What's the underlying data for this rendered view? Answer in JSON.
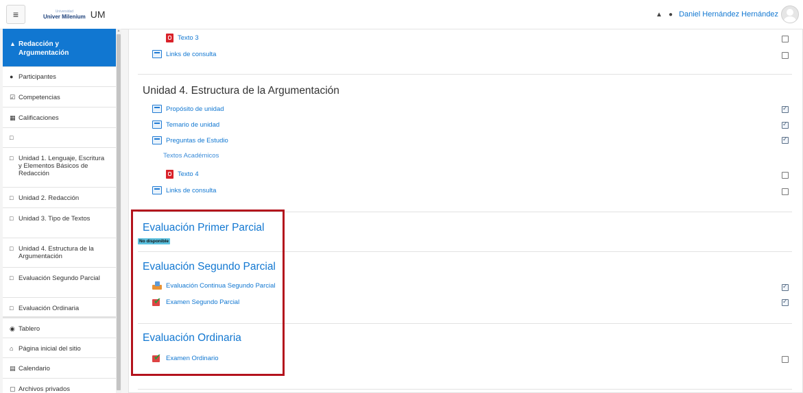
{
  "navbar": {
    "menu_icon": "≡",
    "logo_top": "Universidad",
    "logo_main": "Univer Milenium",
    "site_name": "UM",
    "bell_icon": "🔔",
    "chat_icon": "💬",
    "user_name": "Daniel Hernández Hernández"
  },
  "drawer": {
    "items": [
      {
        "icon": "🎓",
        "label": "Redacción y Argumentación",
        "active": true
      },
      {
        "icon": "👥",
        "label": "Participantes"
      },
      {
        "icon": "☑",
        "label": "Competencias"
      },
      {
        "icon": "▦",
        "label": "Calificaciones"
      },
      {
        "icon": "🗀",
        "label": ""
      },
      {
        "icon": "🗀",
        "label": "Unidad 1. Lenguaje, Escritura y Elementos Básicos de Redacción"
      },
      {
        "icon": "🗀",
        "label": "Unidad 2. Redacción"
      },
      {
        "icon": "🗀",
        "label": "Unidad 3. Tipo de Textos"
      },
      {
        "icon": "🗀",
        "label": "Unidad 4. Estructura de la Argumentación"
      },
      {
        "icon": "🗀",
        "label": "Evaluación Segundo Parcial"
      },
      {
        "icon": "🗀",
        "label": "Evaluación Ordinaria"
      },
      {
        "icon": "🎛",
        "label": "Tablero"
      },
      {
        "icon": "🏠",
        "label": "Página inicial del sitio"
      },
      {
        "icon": "📅",
        "label": "Calendario"
      },
      {
        "icon": "🗋",
        "label": "Archivos privados"
      }
    ]
  },
  "main": {
    "top_activities": [
      {
        "label": "Texto 3",
        "icon": "pdf",
        "completed": false
      },
      {
        "label": "Links de consulta",
        "icon": "page",
        "completed": false
      }
    ],
    "unidad4": {
      "title": "Unidad 4. Estructura de la Argumentación",
      "activities": [
        {
          "label": "Propósito de unidad",
          "icon": "page",
          "completed": true
        },
        {
          "label": "Temario de unidad",
          "icon": "page",
          "completed": true
        },
        {
          "label": "Preguntas de Estudio",
          "icon": "page",
          "completed": true
        }
      ],
      "subheading": "Textos Académicos",
      "activities2": [
        {
          "label": "Texto 4",
          "icon": "pdf",
          "completed": false
        },
        {
          "label": "Links de consulta",
          "icon": "page",
          "completed": false
        }
      ]
    },
    "primer_parcial": {
      "title": "Evaluación Primer Parcial",
      "badge": "No disponible"
    },
    "segundo_parcial": {
      "title": "Evaluación Segundo Parcial",
      "activities": [
        {
          "label": "Evaluación Continua Segundo Parcial",
          "icon": "lesson",
          "completed": true
        },
        {
          "label": "Examen Segundo Parcial",
          "icon": "quiz",
          "completed": true
        }
      ]
    },
    "ordinaria": {
      "title": "Evaluación Ordinaria",
      "activities": [
        {
          "label": "Examen Ordinario",
          "icon": "quiz",
          "completed": false
        }
      ]
    }
  },
  "colors": {
    "accent": "#1177d1",
    "highlight_border": "#b3121c",
    "badge_bg": "#5bc0de"
  }
}
